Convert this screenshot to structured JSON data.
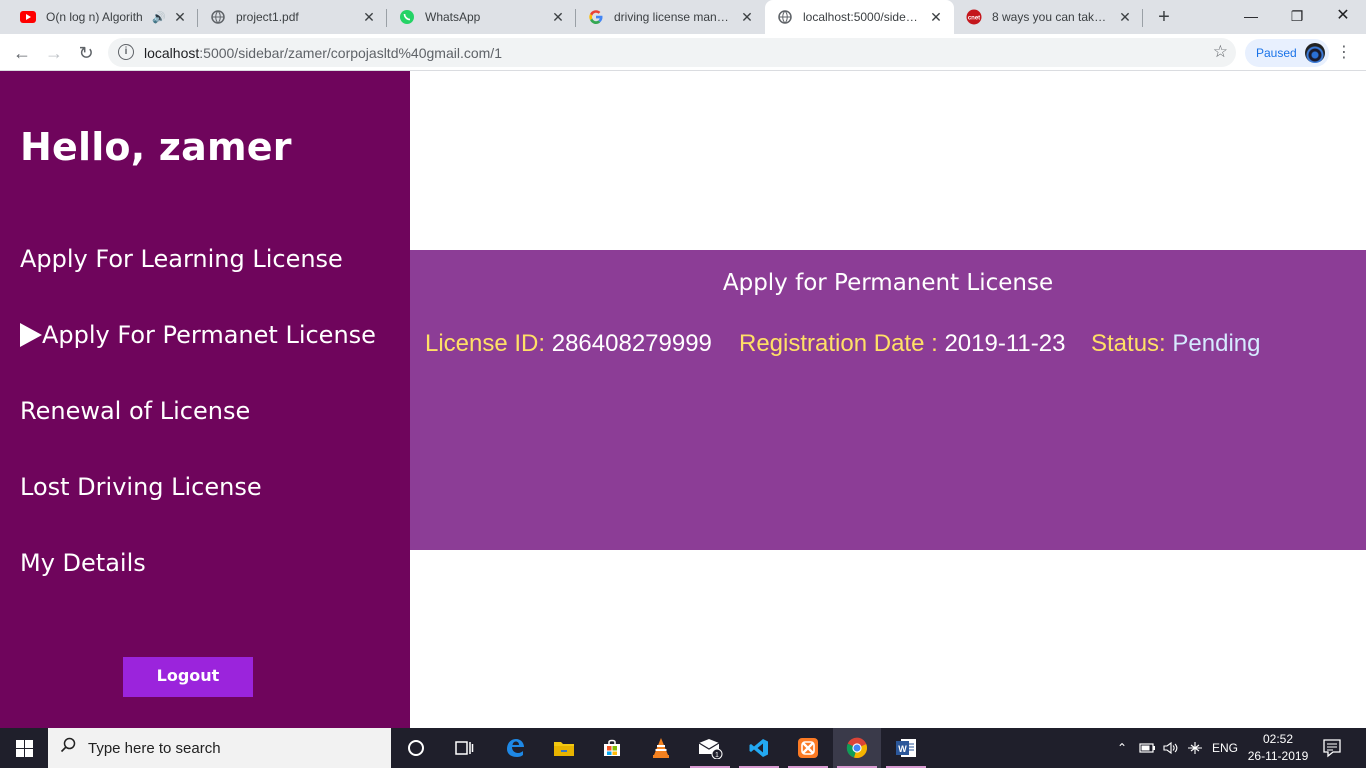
{
  "browser": {
    "tabs": [
      {
        "title": "O(n log n) Algorith",
        "favicon": "youtube-icon",
        "audio": true,
        "active": false
      },
      {
        "title": "project1.pdf",
        "favicon": "globe-icon",
        "audio": false,
        "active": false
      },
      {
        "title": "WhatsApp",
        "favicon": "whatsapp-icon",
        "audio": false,
        "active": false
      },
      {
        "title": "driving license manage",
        "favicon": "google-icon",
        "audio": false,
        "active": false
      },
      {
        "title": "localhost:5000/sidebar/",
        "favicon": "globe-icon",
        "audio": false,
        "active": true
      },
      {
        "title": "8 ways you can take scr",
        "favicon": "cnet-icon",
        "audio": false,
        "active": false
      }
    ],
    "url_host": "localhost",
    "url_rest": ":5000/sidebar/zamer/corpojasltd%40gmail.com/1",
    "profile_label": "Paused"
  },
  "sidebar": {
    "greeting": "Hello, zamer",
    "items": [
      {
        "label": "Apply For Learning License",
        "selected": false
      },
      {
        "label": "Apply For Permanet License",
        "selected": true
      },
      {
        "label": "Renewal of License",
        "selected": false
      },
      {
        "label": "Lost Driving License",
        "selected": false
      },
      {
        "label": "My Details",
        "selected": false
      }
    ],
    "logout_label": "Logout"
  },
  "panel": {
    "title": "Apply for Permanent License",
    "license_id_label": "License ID:",
    "license_id": "286408279999",
    "reg_date_label": "Registration Date :",
    "reg_date": "2019-11-23",
    "status_label": "Status:",
    "status": "Pending"
  },
  "taskbar": {
    "search_placeholder": "Type here to search",
    "language": "ENG",
    "time": "02:52",
    "date": "26-11-2019",
    "mail_badge": "1"
  },
  "colors": {
    "sidebar_bg": "#6f055c",
    "panel_bg": "#8c3d96",
    "label_yellow": "#ffe066",
    "logout_bg": "#9b24dc"
  }
}
